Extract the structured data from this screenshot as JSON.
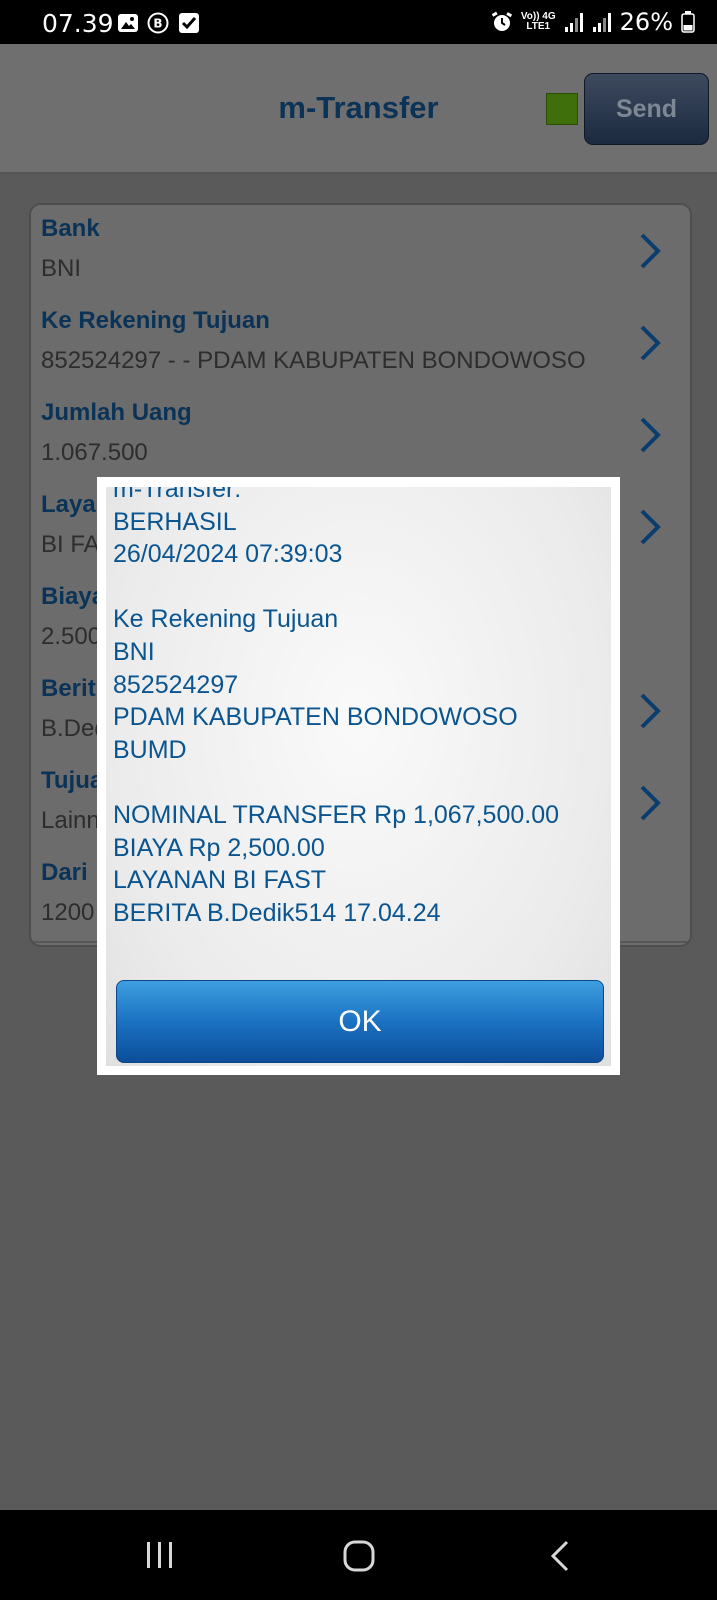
{
  "status_bar": {
    "time": "07.39",
    "network_top": "Vo)) 4G",
    "network_bottom": "LTE1",
    "battery": "26%"
  },
  "header": {
    "title": "m-Transfer",
    "send_label": "Send",
    "indicator_color": "#3f6f0b"
  },
  "form": {
    "rows": [
      {
        "label": "Bank",
        "value": "BNI",
        "has_chevron": true
      },
      {
        "label": "Ke Rekening Tujuan",
        "value": "852524297 - - PDAM KABUPATEN BONDOWOSO",
        "has_chevron": true
      },
      {
        "label": "Jumlah Uang",
        "value": "1.067.500",
        "has_chevron": true
      },
      {
        "label": "Layan",
        "value": "BI FA",
        "has_chevron": true
      },
      {
        "label": "Biaya",
        "value": "2.500",
        "has_chevron": false
      },
      {
        "label": "Berit",
        "value": "B.Ded",
        "has_chevron": true
      },
      {
        "label": "Tujua",
        "value": "Lainn",
        "has_chevron": true
      },
      {
        "label": "Dari",
        "value": "1200",
        "has_chevron": false
      }
    ]
  },
  "dialog": {
    "lines": [
      "m-Transfer:",
      "BERHASIL",
      "26/04/2024 07:39:03",
      "",
      "Ke Rekening Tujuan",
      "BNI",
      "852524297",
      "PDAM KABUPATEN BONDOWOSO",
      "BUMD",
      "",
      "NOMINAL TRANSFER Rp 1,067,500.00",
      "BIAYA Rp 2,500.00",
      "LAYANAN BI FAST",
      "BERITA B.Dedik514 17.04.24"
    ],
    "ok_label": "OK"
  },
  "colors": {
    "accent_text": "#0a3357",
    "dialog_text": "#0a5590",
    "ok_button": "#1b72c2"
  }
}
